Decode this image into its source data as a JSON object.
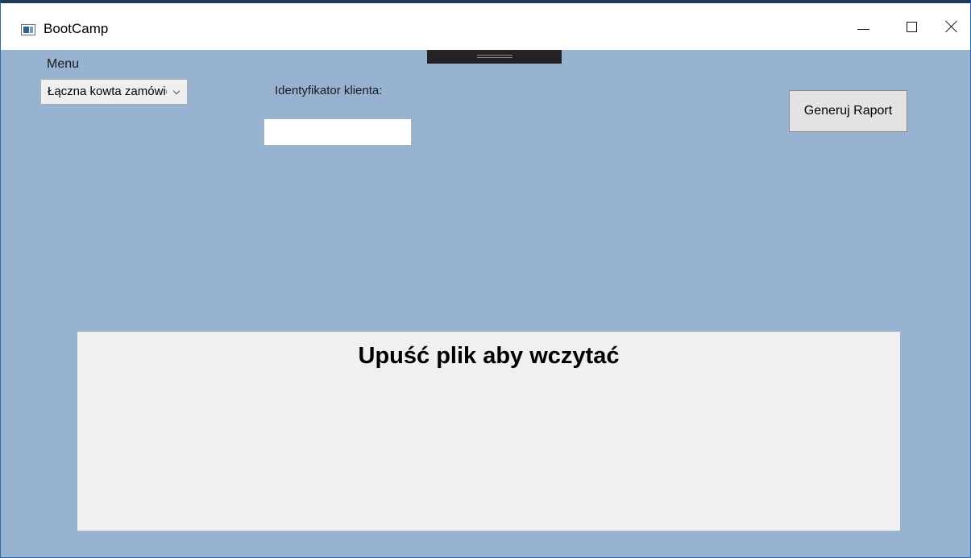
{
  "window": {
    "title": "BootCamp"
  },
  "menu": {
    "label": "Menu",
    "selected": "Łączna kowta zamówień"
  },
  "client_id": {
    "label": "Identyfikator klienta:",
    "value": "",
    "placeholder": ""
  },
  "report_button": {
    "label": "Generuj Raport"
  },
  "drop_zone": {
    "text": "Upuść plik aby wczytać"
  },
  "colors": {
    "client_background": "#98b3d1",
    "drop_zone_background": "#f0f0f0",
    "drag_handle": "#232323"
  }
}
